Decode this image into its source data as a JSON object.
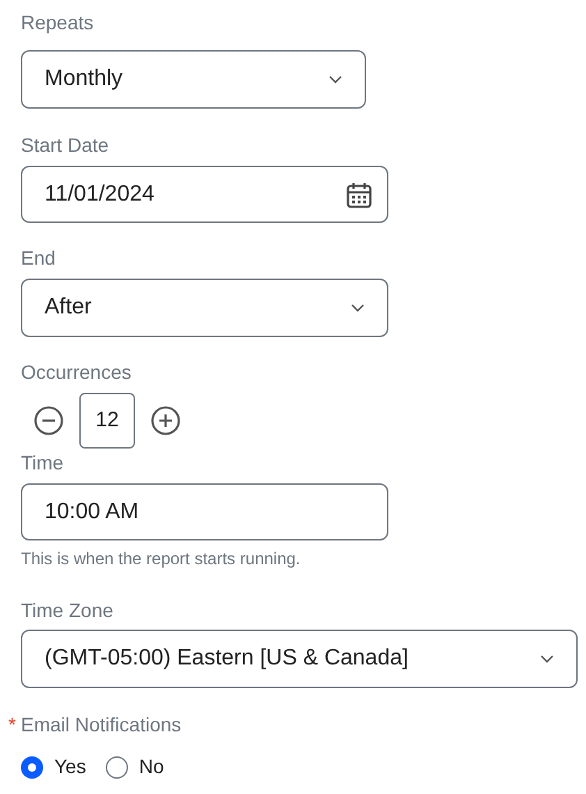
{
  "repeats": {
    "label": "Repeats",
    "value": "Monthly"
  },
  "start_date": {
    "label": "Start Date",
    "value": "11/01/2024"
  },
  "end": {
    "label": "End",
    "value": "After"
  },
  "occurrences": {
    "label": "Occurrences",
    "value": "12"
  },
  "time": {
    "label": "Time",
    "value": "10:00 AM",
    "hint": "This is when the report starts running."
  },
  "time_zone": {
    "label": "Time Zone",
    "value": "(GMT-05:00) Eastern [US & Canada]"
  },
  "email_notifications": {
    "required_mark": "*",
    "label": "Email Notifications",
    "options": [
      {
        "label": "Yes",
        "selected": true
      },
      {
        "label": "No",
        "selected": false
      }
    ]
  }
}
